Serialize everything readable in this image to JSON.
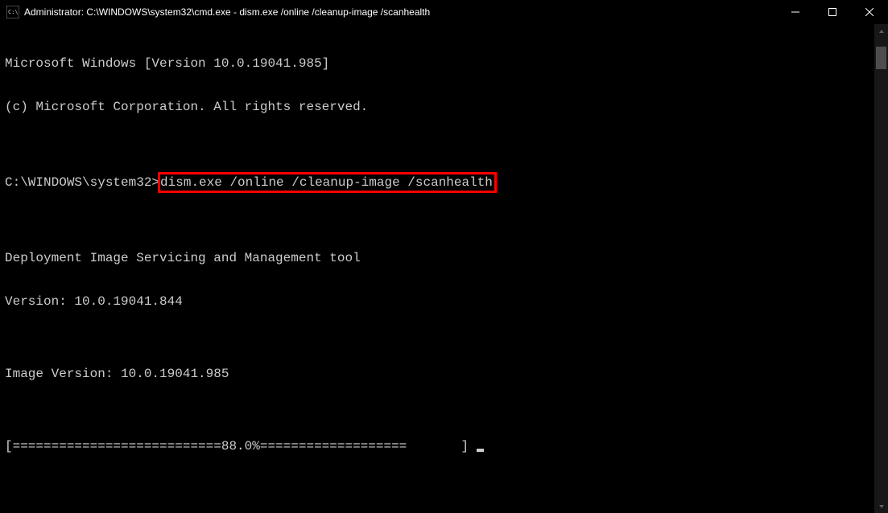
{
  "titlebar": {
    "text": "Administrator: C:\\WINDOWS\\system32\\cmd.exe - dism.exe  /online /cleanup-image /scanhealth"
  },
  "terminal": {
    "line1": "Microsoft Windows [Version 10.0.19041.985]",
    "line2": "(c) Microsoft Corporation. All rights reserved.",
    "blank1": "",
    "prompt_prefix": "C:\\WINDOWS\\system32>",
    "command": "dism.exe /online /cleanup-image /scanhealth",
    "blank2": "",
    "line5": "Deployment Image Servicing and Management tool",
    "line6": "Version: 10.0.19041.844",
    "blank3": "",
    "line8": "Image Version: 10.0.19041.985",
    "blank4": "",
    "progress": "[===========================88.0%===================       ] "
  }
}
